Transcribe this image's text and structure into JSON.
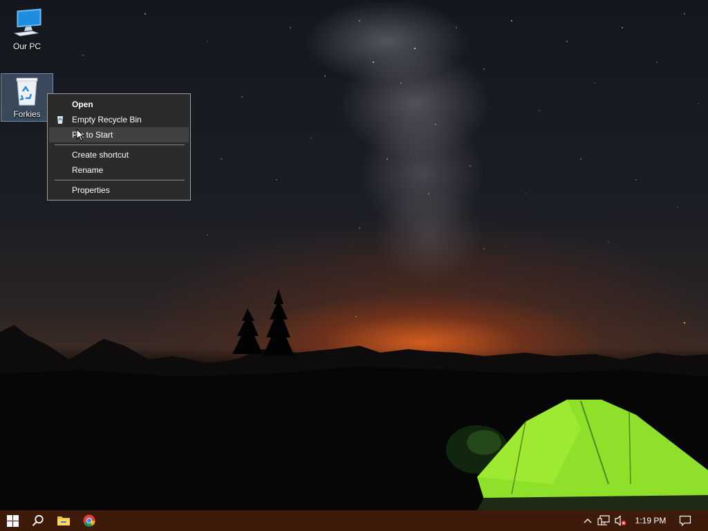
{
  "desktop": {
    "icons": [
      {
        "label": "Our PC",
        "icon": "computer-icon"
      },
      {
        "label": "Forkies",
        "icon": "recycle-bin-icon"
      }
    ]
  },
  "context_menu": {
    "items": [
      {
        "label": "Open",
        "bold": true
      },
      {
        "label": "Empty Recycle Bin",
        "icon": "recycle-bin-icon"
      },
      {
        "label": "Pin to Start",
        "highlighted": true
      },
      {
        "label": "Create shortcut"
      },
      {
        "label": "Rename"
      },
      {
        "label": "Properties"
      }
    ]
  },
  "taskbar": {
    "buttons": [
      {
        "name": "start",
        "icon": "windows-logo-icon"
      },
      {
        "name": "search",
        "icon": "search-icon"
      },
      {
        "name": "file-explorer",
        "icon": "folder-icon"
      },
      {
        "name": "chrome",
        "icon": "chrome-icon"
      }
    ],
    "tray": {
      "icons": [
        "chevron-up-icon",
        "network-icon",
        "volume-muted-icon"
      ],
      "clock": "1:19 PM",
      "action_center_icon": "notification-icon"
    },
    "color": "#3d1a0a"
  },
  "colors": {
    "menu_bg": "#2b2b2b",
    "menu_hover": "#414141",
    "tent": "#8fe02a"
  }
}
